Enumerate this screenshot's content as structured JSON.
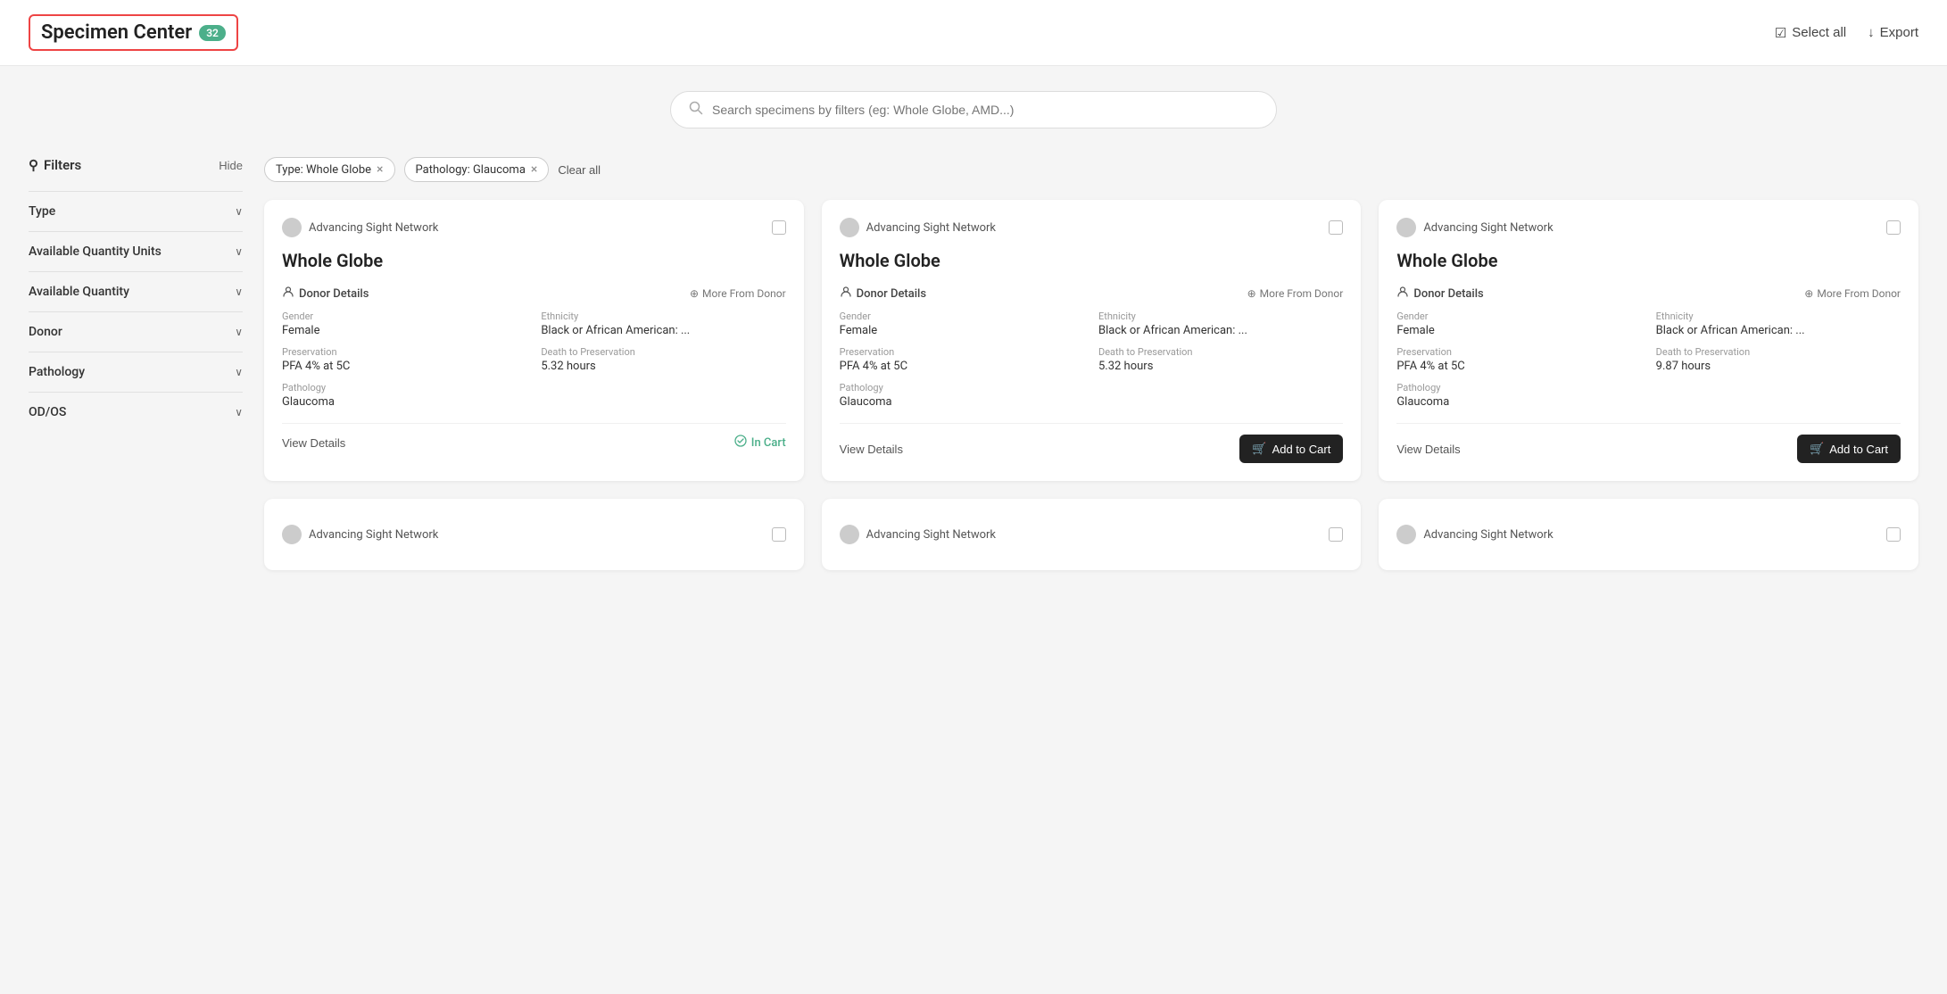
{
  "header": {
    "title": "Specimen Center",
    "count": "32",
    "select_all": "Select all",
    "export": "Export"
  },
  "search": {
    "placeholder": "Search specimens by filters (eg: Whole Globe, AMD...)"
  },
  "filters": {
    "label": "Filters",
    "hide": "Hide",
    "active_filters": [
      {
        "label": "Type: Whole Globe"
      },
      {
        "label": "Pathology: Glaucoma"
      }
    ],
    "clear_all": "Clear all"
  },
  "sidebar": {
    "sections": [
      {
        "label": "Type"
      },
      {
        "label": "Available Quantity Units"
      },
      {
        "label": "Available Quantity"
      },
      {
        "label": "Donor"
      },
      {
        "label": "Pathology"
      },
      {
        "label": "OD/OS"
      }
    ]
  },
  "cards": [
    {
      "network": "Advancing Sight Network",
      "title": "Whole Globe",
      "donor_details": "Donor Details",
      "more_from_donor": "More From Donor",
      "gender_label": "Gender",
      "gender_value": "Female",
      "ethnicity_label": "Ethnicity",
      "ethnicity_value": "Black or African American: ...",
      "preservation_label": "Preservation",
      "preservation_value": "PFA 4% at 5C",
      "death_to_pres_label": "Death to Preservation",
      "death_to_pres_value": "5.32 hours",
      "pathology_label": "Pathology",
      "pathology_value": "Glaucoma",
      "view_details": "View Details",
      "action": "in_cart",
      "action_label": "In Cart"
    },
    {
      "network": "Advancing Sight Network",
      "title": "Whole Globe",
      "donor_details": "Donor Details",
      "more_from_donor": "More From Donor",
      "gender_label": "Gender",
      "gender_value": "Female",
      "ethnicity_label": "Ethnicity",
      "ethnicity_value": "Black or African American: ...",
      "preservation_label": "Preservation",
      "preservation_value": "PFA 4% at 5C",
      "death_to_pres_label": "Death to Preservation",
      "death_to_pres_value": "5.32 hours",
      "pathology_label": "Pathology",
      "pathology_value": "Glaucoma",
      "view_details": "View Details",
      "action": "add_to_cart",
      "action_label": "Add to Cart"
    },
    {
      "network": "Advancing Sight Network",
      "title": "Whole Globe",
      "donor_details": "Donor Details",
      "more_from_donor": "More From Donor",
      "gender_label": "Gender",
      "gender_value": "Female",
      "ethnicity_label": "Ethnicity",
      "ethnicity_value": "Black or African American: ...",
      "preservation_label": "Preservation",
      "preservation_value": "PFA 4% at 5C",
      "death_to_pres_label": "Death to Preservation",
      "death_to_pres_value": "9.87 hours",
      "pathology_label": "Pathology",
      "pathology_value": "Glaucoma",
      "view_details": "View Details",
      "action": "add_to_cart",
      "action_label": "Add to Cart"
    }
  ],
  "row2_networks": [
    "Advancing Sight Network",
    "Advancing Sight Network",
    "Advancing Sight Network"
  ],
  "icons": {
    "filter": "⚲",
    "chevron": "›",
    "search": "🔍",
    "donor": "👤",
    "more": "⊕",
    "cart": "🛒",
    "check": "✓",
    "export": "↓",
    "checkbox_checked": "☑"
  }
}
